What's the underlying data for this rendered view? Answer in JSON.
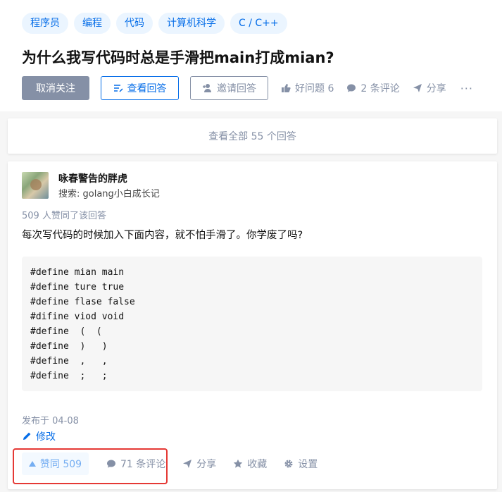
{
  "question": {
    "topics": [
      "程序员",
      "编程",
      "代码",
      "计算机科学",
      "C / C++"
    ],
    "title": "为什么我写代码时总是手滑把main打成mian?",
    "actions": {
      "unfollow": "取消关注",
      "view_answers": "查看回答",
      "invite": "邀请回答",
      "good_question": "好问题 6",
      "comments": "2 条评论",
      "share": "分享",
      "more": "···"
    }
  },
  "view_all": "查看全部 55 个回答",
  "answer": {
    "author_name": "咏春警告的胖虎",
    "author_headline": "搜索: golang小白成长记",
    "vote_summary": "509 人赞同了该回答",
    "text": "每次写代码的时候加入下面内容，就不怕手滑了。你学废了吗?",
    "code_lines": [
      "#define mian main",
      "#define ture true",
      "#define flase false",
      "#difine viod void",
      "#define  (  (",
      "#define  )   )",
      "#define  ,   ,",
      "#define  ;   ;"
    ],
    "published": "发布于 04-08",
    "edit": "修改",
    "actions": {
      "upvote": "赞同 509",
      "comments": "71 条评论",
      "share": "分享",
      "collect": "收藏",
      "settings": "设置"
    }
  },
  "colors": {
    "brand_blue": "#056de8",
    "muted_gray": "#8590a6",
    "highlight_red": "#e53935"
  }
}
